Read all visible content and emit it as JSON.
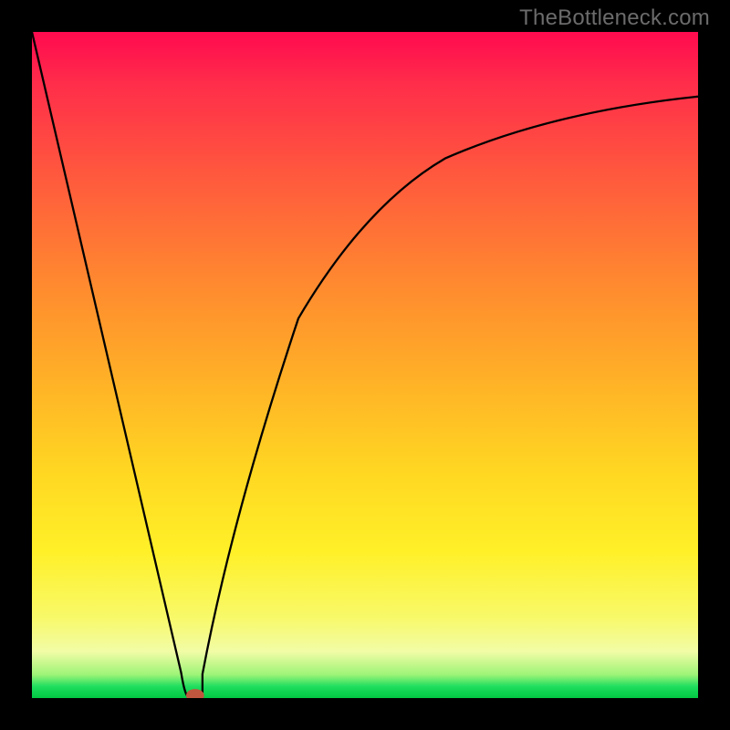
{
  "watermark": {
    "text": "TheBottleneck.com"
  },
  "chart_data": {
    "type": "line",
    "title": "",
    "xlabel": "",
    "ylabel": "",
    "xlim": [
      0,
      100
    ],
    "ylim": [
      0,
      100
    ],
    "grid": false,
    "legend": false,
    "annotations": [],
    "background_gradient": {
      "orientation": "vertical",
      "stops": [
        {
          "pos": 0.0,
          "color": "#ff0a4f"
        },
        {
          "pos": 0.22,
          "color": "#ff5a3d"
        },
        {
          "pos": 0.52,
          "color": "#ffb027"
        },
        {
          "pos": 0.78,
          "color": "#fff028"
        },
        {
          "pos": 0.93,
          "color": "#f2fca6"
        },
        {
          "pos": 1.0,
          "color": "#04c842"
        }
      ]
    },
    "marker": {
      "x": 24.5,
      "y": 0.3,
      "color": "#c1563e",
      "rx": 1.4,
      "ry": 1.0
    },
    "series": [
      {
        "name": "curve",
        "color": "#000000",
        "x": [
          0.0,
          5.0,
          10.0,
          15.0,
          20.0,
          22.5,
          23.2,
          24.0,
          24.8,
          25.6,
          27.0,
          30.0,
          35.0,
          40.0,
          45.0,
          50.0,
          55.0,
          60.0,
          65.0,
          70.0,
          75.0,
          80.0,
          85.0,
          90.0,
          95.0,
          100.0
        ],
        "y": [
          100.0,
          78.5,
          57.0,
          35.5,
          14.0,
          3.5,
          0.6,
          0.0,
          0.6,
          3.5,
          11.0,
          27.0,
          45.0,
          57.0,
          65.0,
          71.0,
          75.5,
          79.0,
          81.8,
          84.0,
          85.9,
          87.4,
          88.5,
          89.3,
          89.9,
          90.3
        ]
      }
    ]
  }
}
